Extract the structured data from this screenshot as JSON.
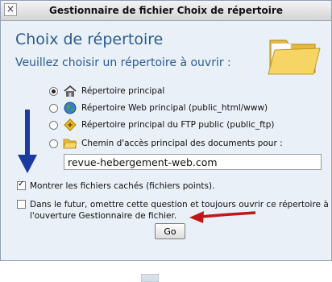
{
  "window": {
    "title": "Gestionnaire de fichier Choix de répertoire",
    "close_glyph": "×"
  },
  "dialog": {
    "heading": "Choix de répertoire",
    "subheading": "Veuillez choisir un répertoire à ouvrir :"
  },
  "options": [
    {
      "label": "Répertoire principal",
      "icon": "home-icon",
      "checked": true
    },
    {
      "label": "Répertoire Web principal (public_html/www)",
      "icon": "globe-icon",
      "checked": false
    },
    {
      "label": "Répertoire principal du FTP public (public_ftp)",
      "icon": "ftp-icon",
      "checked": false
    },
    {
      "label": "Chemin d'accès principal des documents pour :",
      "icon": "folder-icon",
      "checked": false
    }
  ],
  "path_input": {
    "value": "revue-hebergement-web.com"
  },
  "show_hidden": {
    "label": "Montrer les fichiers cachés (fichiers points).",
    "checked": true
  },
  "remember": {
    "label_line1": "Dans le futur, omettre cette question et toujours ouvrir ce répertoire à",
    "label_line2": "l'ouverture Gestionnaire de fichier.",
    "checked": false
  },
  "go_button": {
    "label": "Go"
  },
  "colors": {
    "heading": "#2b5b93",
    "annotation_arrow_blue": "#1a3aa0",
    "annotation_arrow_red": "#c01818"
  }
}
